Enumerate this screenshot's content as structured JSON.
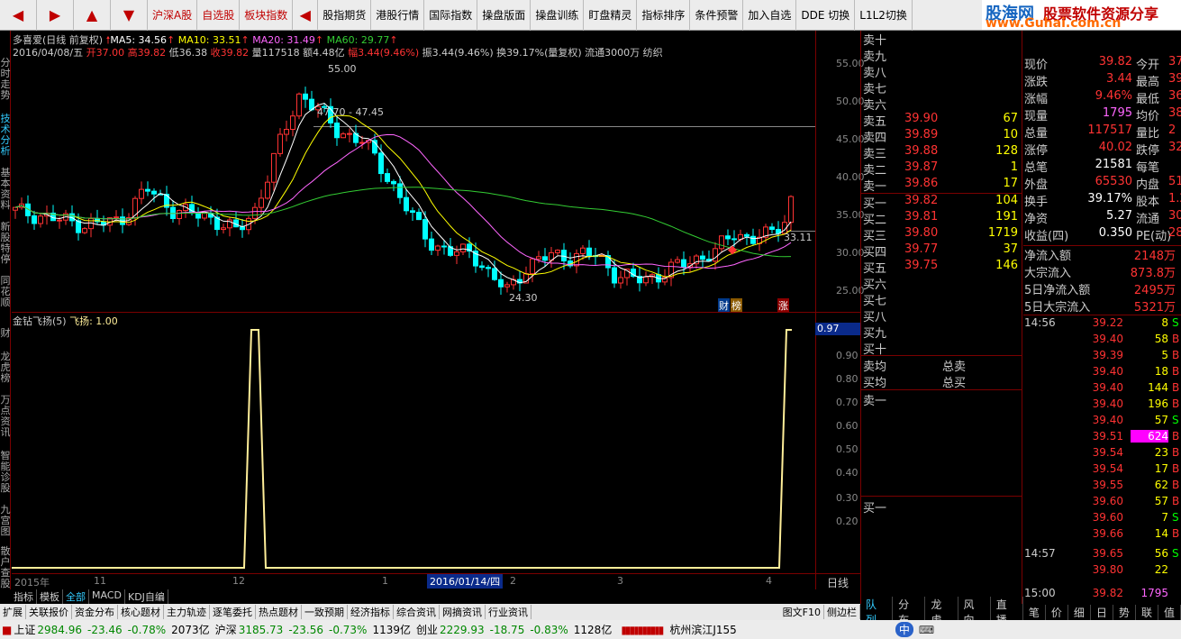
{
  "toolbar": {
    "items": [
      "沪深A股",
      "自选股",
      "板块指数",
      "股指期货",
      "港股行情",
      "国际指数",
      "操盘版面",
      "操盘训练",
      "盯盘精灵",
      "指标排序",
      "条件预警",
      "加入自选",
      "DDE 切换",
      "L1L2切换"
    ]
  },
  "logo": {
    "name": "股海网",
    "slogan": "股票软件资源分享",
    "url": "www.Guhai.com.cn"
  },
  "left_tabs": [
    "分时走势",
    "技术分析",
    "基本资料",
    "新股特停",
    "同花顺",
    "财",
    "龙虎榜",
    "万点资讯",
    "智能诊股",
    "九宫图",
    "散户查股"
  ],
  "chart_header": {
    "stock": "多喜爱(日线 前复权)",
    "ma5": "MA5: 34.56",
    "ma10": "MA10: 33.51",
    "ma20": "MA20: 31.49",
    "ma60": "MA60: 29.77",
    "info_date": "2016/04/08/五",
    "info_open": "开37.00",
    "info_high": "高39.82",
    "info_low": "低36.38",
    "info_close": "收39.82",
    "info_vol": "量117518",
    "info_amt": "额4.48亿",
    "info_pct": "幅3.44(9.46%)",
    "info_rest": "振3.44(9.46%) 换39.17%(量复权) 流通3000万 纺织"
  },
  "chart_annotations": {
    "high_label": "55.00",
    "mid_label": "47.70 - 47.45",
    "low_label": "24.30",
    "right_price": "33.11",
    "badge_cai": "财",
    "badge_bang": "榜",
    "badge_zhang": "涨"
  },
  "indicator": {
    "title": "金钻飞扬(5)",
    "value": "飞扬: 1.00",
    "current": "0.97"
  },
  "price_axis": [
    "55.00",
    "50.00",
    "45.00",
    "40.00",
    "35.00",
    "30.00",
    "25.00"
  ],
  "ind_axis": [
    "0.90",
    "0.80",
    "0.70",
    "0.60",
    "0.50",
    "0.40",
    "0.30",
    "0.20"
  ],
  "x_axis": {
    "labels": [
      "2015年",
      "11",
      "12",
      "1",
      "2",
      "3",
      "4"
    ],
    "cursor": "2016/01/14/四",
    "period": "日线"
  },
  "chart_data": {
    "type": "line",
    "series": [
      {
        "name": "MA5",
        "values": []
      },
      {
        "name": "MA10",
        "values": []
      },
      {
        "name": "MA20",
        "values": []
      },
      {
        "name": "MA60",
        "values": []
      }
    ],
    "indicator_series": {
      "name": "飞扬",
      "ylim": [
        0,
        1
      ]
    },
    "ylim": [
      22,
      57
    ]
  },
  "orderbook": {
    "sell": [
      {
        "name": "卖十",
        "price": "",
        "vol": ""
      },
      {
        "name": "卖九",
        "price": "",
        "vol": ""
      },
      {
        "name": "卖八",
        "price": "",
        "vol": ""
      },
      {
        "name": "卖七",
        "price": "",
        "vol": ""
      },
      {
        "name": "卖六",
        "price": "",
        "vol": ""
      },
      {
        "name": "卖五",
        "price": "39.90",
        "vol": "67"
      },
      {
        "name": "卖四",
        "price": "39.89",
        "vol": "10"
      },
      {
        "name": "卖三",
        "price": "39.88",
        "vol": "128"
      },
      {
        "name": "卖二",
        "price": "39.87",
        "vol": "1"
      },
      {
        "name": "卖一",
        "price": "39.86",
        "vol": "17"
      }
    ],
    "buy": [
      {
        "name": "买一",
        "price": "39.82",
        "vol": "104"
      },
      {
        "name": "买二",
        "price": "39.81",
        "vol": "191"
      },
      {
        "name": "买三",
        "price": "39.80",
        "vol": "1719"
      },
      {
        "name": "买四",
        "price": "39.77",
        "vol": "37"
      },
      {
        "name": "买五",
        "price": "39.75",
        "vol": "146"
      },
      {
        "name": "买六",
        "price": "",
        "vol": ""
      },
      {
        "name": "买七",
        "price": "",
        "vol": ""
      },
      {
        "name": "买八",
        "price": "",
        "vol": ""
      },
      {
        "name": "买九",
        "price": "",
        "vol": ""
      },
      {
        "name": "买十",
        "price": "",
        "vol": ""
      }
    ],
    "avg_sell": "卖均",
    "avg_buy": "买均",
    "total_sell": "总卖",
    "total_buy": "总买",
    "bottom_sell1": "卖一",
    "bottom_buy1": "买一"
  },
  "quote": [
    {
      "l1": "现价",
      "v1": "39.82",
      "l2": "今开",
      "v2": "37"
    },
    {
      "l1": "涨跌",
      "v1": "3.44",
      "l2": "最高",
      "v2": "39"
    },
    {
      "l1": "涨幅",
      "v1": "9.46%",
      "l2": "最低",
      "v2": "36"
    },
    {
      "l1": "现量",
      "v1": "1795",
      "l2": "均价",
      "v2": "38"
    },
    {
      "l1": "总量",
      "v1": "117517",
      "l2": "量比",
      "v2": "2"
    },
    {
      "l1": "涨停",
      "v1": "40.02",
      "l2": "跌停",
      "v2": "32"
    },
    {
      "l1": "总笔",
      "v1": "21581",
      "l2": "每笔",
      "v2": ""
    },
    {
      "l1": "外盘",
      "v1": "65530",
      "l2": "内盘",
      "v2": "51"
    },
    {
      "l1": "换手",
      "v1": "39.17%",
      "l2": "股本",
      "v2": "1.2"
    },
    {
      "l1": "净资",
      "v1": "5.27",
      "l2": "流通",
      "v2": "300"
    },
    {
      "l1": "收益(四)",
      "v1": "0.350",
      "l2": "PE(动)",
      "v2": "28"
    }
  ],
  "flows": [
    {
      "label": "净流入额",
      "value": "2148万"
    },
    {
      "label": "大宗流入",
      "value": "873.8万"
    },
    {
      "label": "5日净流入额",
      "value": "2495万"
    },
    {
      "label": "5日大宗流入",
      "value": "5321万"
    }
  ],
  "ticks": [
    {
      "time": "14:56",
      "price": "39.22",
      "vol": "8",
      "side": "S"
    },
    {
      "time": "",
      "price": "39.40",
      "vol": "58",
      "side": "B"
    },
    {
      "time": "",
      "price": "39.39",
      "vol": "5",
      "side": "B"
    },
    {
      "time": "",
      "price": "39.40",
      "vol": "18",
      "side": "B"
    },
    {
      "time": "",
      "price": "39.40",
      "vol": "144",
      "side": "B"
    },
    {
      "time": "",
      "price": "39.40",
      "vol": "196",
      "side": "B"
    },
    {
      "time": "",
      "price": "39.40",
      "vol": "57",
      "side": "S"
    },
    {
      "time": "",
      "price": "39.51",
      "vol": "624",
      "side": "B"
    },
    {
      "time": "",
      "price": "39.54",
      "vol": "23",
      "side": "B"
    },
    {
      "time": "",
      "price": "39.54",
      "vol": "17",
      "side": "B"
    },
    {
      "time": "",
      "price": "39.55",
      "vol": "62",
      "side": "B"
    },
    {
      "time": "",
      "price": "39.60",
      "vol": "57",
      "side": "B"
    },
    {
      "time": "",
      "price": "39.60",
      "vol": "7",
      "side": "S"
    },
    {
      "time": "",
      "price": "39.66",
      "vol": "14",
      "side": "B"
    },
    {
      "time": "14:57",
      "price": "39.65",
      "vol": "56",
      "side": "S"
    },
    {
      "time": "",
      "price": "39.80",
      "vol": "22",
      "side": ""
    },
    {
      "time": "15:00",
      "price": "39.82",
      "vol": "1795",
      "side": ""
    }
  ],
  "bottom_tabs": [
    "指标",
    "模板",
    "全部",
    "MACD",
    "KDJ自编"
  ],
  "funcbar": [
    "扩展",
    "关联报价",
    "资金分布",
    "核心题材",
    "主力轨迹",
    "逐笔委托",
    "热点题材",
    "一致预期",
    "经济指标",
    "综合资讯",
    "网摘资讯",
    "行业资讯",
    "图文F10",
    "侧边栏"
  ],
  "right_tabs": [
    "队列",
    "分布",
    "龙虎",
    "风向",
    "直播",
    "笔",
    "价",
    "细",
    "日",
    "势",
    "联",
    "值"
  ],
  "status": {
    "sh_label": "上证",
    "sh_val": "2984.96",
    "sh_chg": "-23.46",
    "sh_pct": "-0.78%",
    "sh_amt": "2073亿",
    "hs_label": "沪深",
    "hs_val": "3185.73",
    "hs_chg": "-23.56",
    "hs_pct": "-0.73%",
    "hs_amt": "1139亿",
    "cy_label": "创业",
    "cy_val": "2229.93",
    "cy_chg": "-18.75",
    "cy_pct": "-0.83%",
    "cy_amt": "1128亿",
    "location": "杭州滨江J155",
    "ime": "中"
  },
  "colors": {
    "up": "#ff3333",
    "down": "#00ffff",
    "ma5": "#ffffff",
    "ma10": "#ffff00",
    "ma20": "#ff66ff",
    "ma60": "#33cc33",
    "indicator": "#ffee99"
  }
}
